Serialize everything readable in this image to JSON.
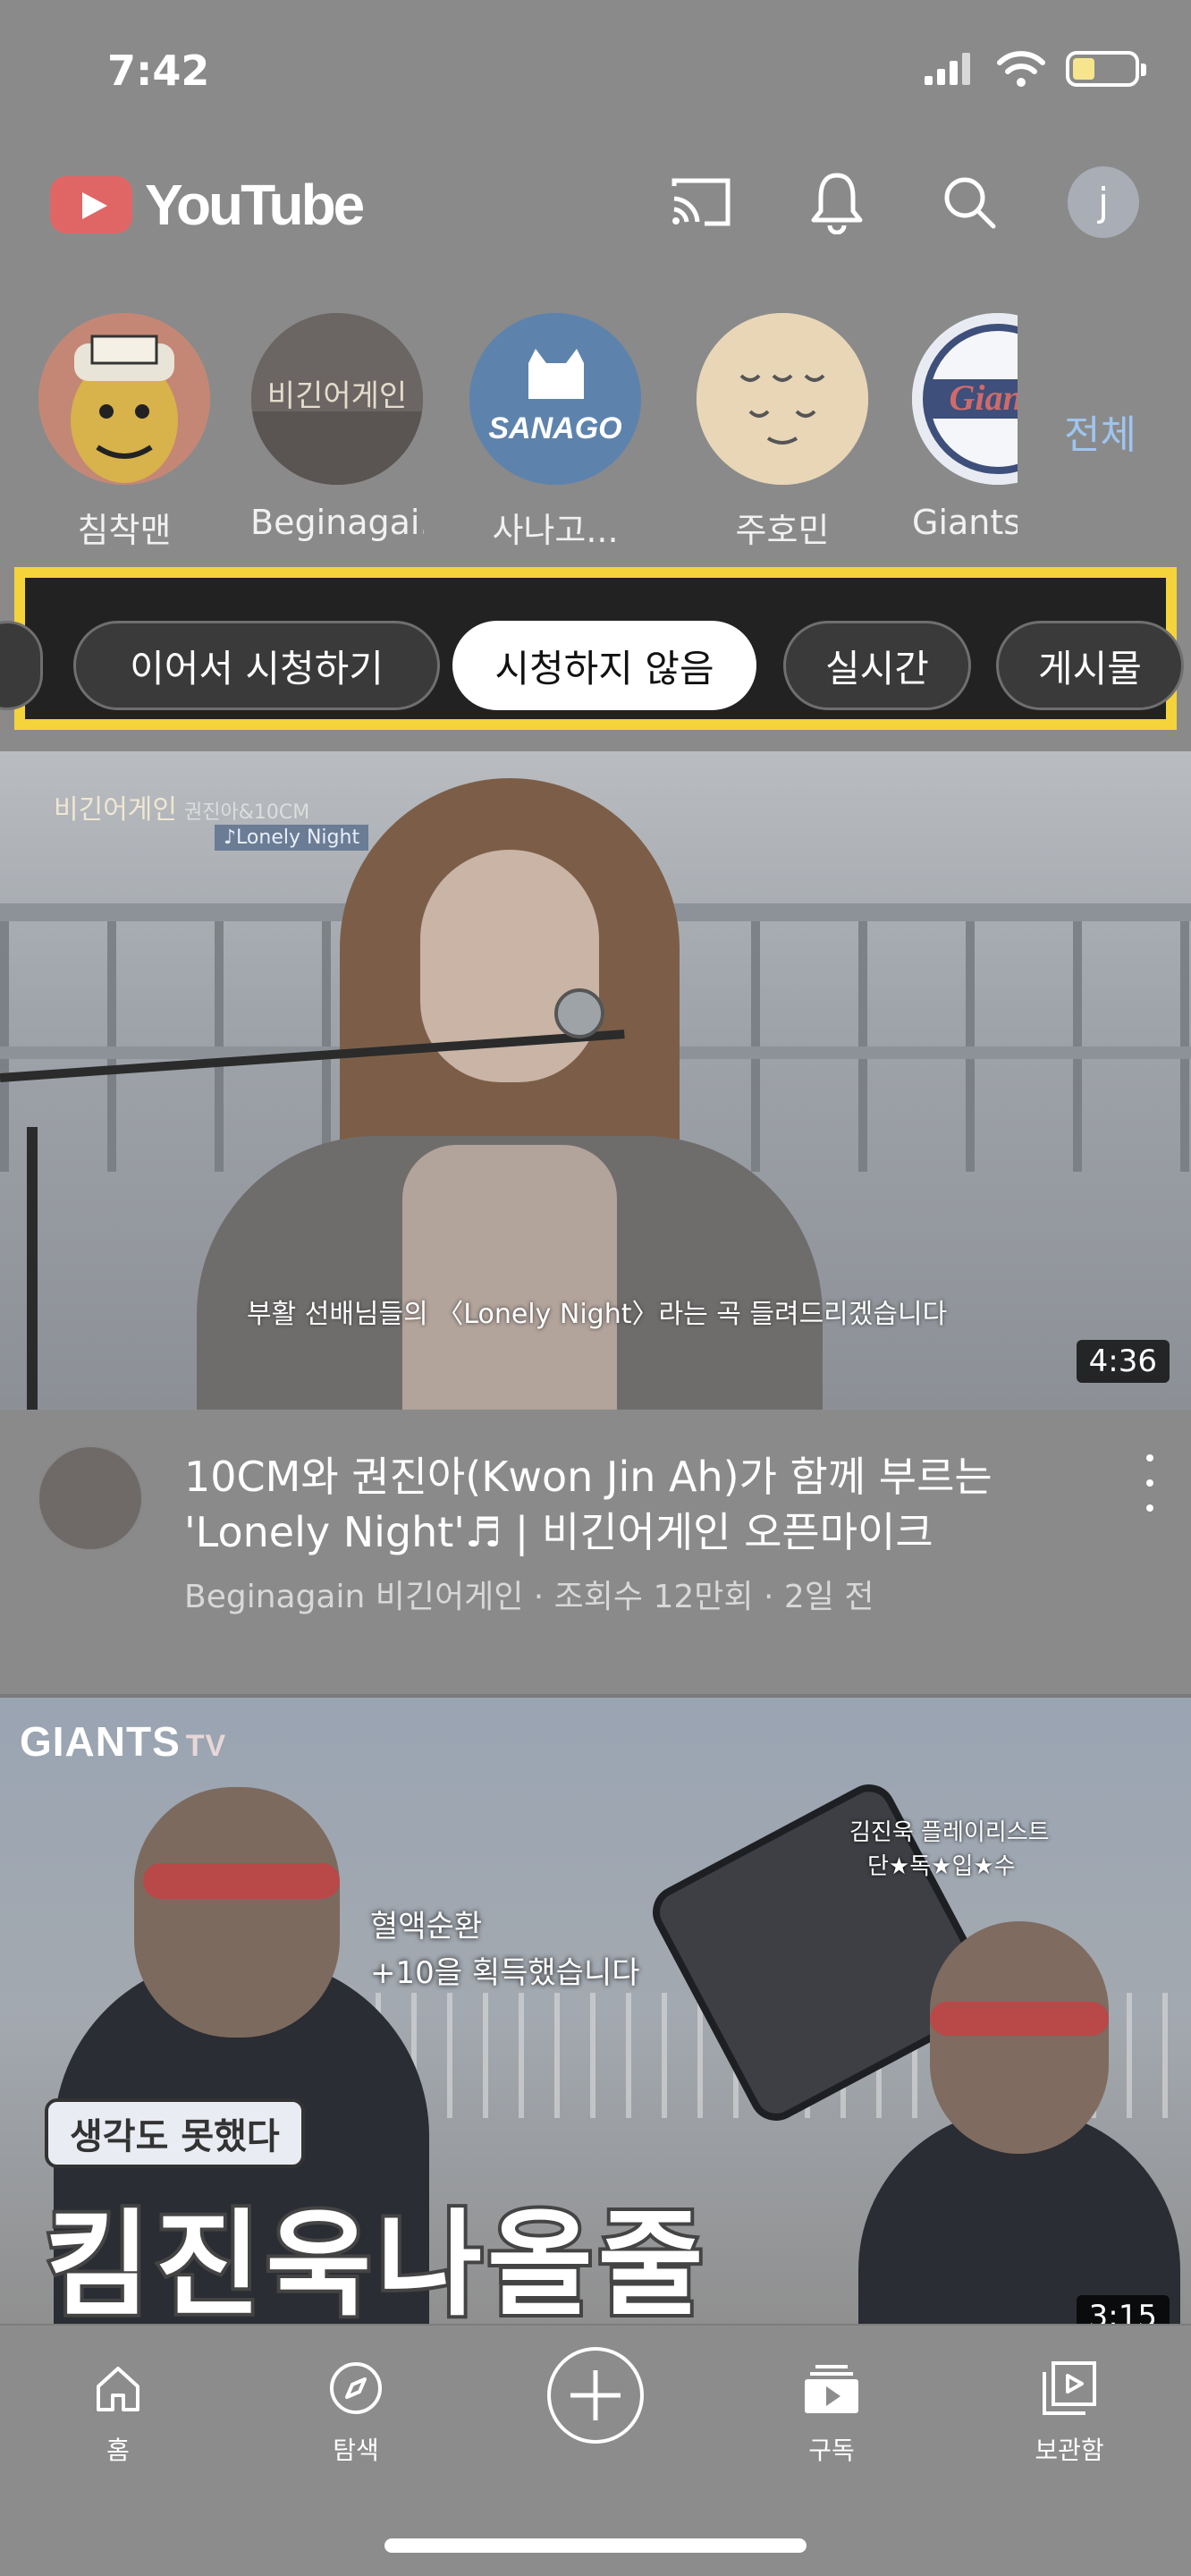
{
  "status_bar": {
    "time": "7:42"
  },
  "header": {
    "logo_text": "YouTube",
    "avatar_letter": "j"
  },
  "channels": {
    "items": [
      {
        "label": "침착맨"
      },
      {
        "label": "Beginagai..."
      },
      {
        "label": "사나고..."
      },
      {
        "label": "주호민"
      },
      {
        "label": "Giants"
      }
    ],
    "all_label": "전체",
    "sanago_logo_text": "SANAGO",
    "giants_logo_text": "Giants"
  },
  "chips": {
    "items": [
      {
        "label": "이어서 시청하기",
        "active": false
      },
      {
        "label": "시청하지 않음",
        "active": true
      },
      {
        "label": "실시간",
        "active": false
      },
      {
        "label": "게시물",
        "active": false
      }
    ],
    "highlight_color": "#f5d33b"
  },
  "videos": [
    {
      "thumb_overlay_title": "비긴어게인",
      "thumb_overlay_artists": "권진아&10CM",
      "thumb_overlay_song": "♪Lonely Night",
      "thumb_subtitle": "부활 선배님들의 〈Lonely Night〉라는 곡 들려드리겠습니다",
      "duration": "4:36",
      "title": "10CM와 권진아(Kwon Jin Ah)가 함께 부르는 'Lonely Night'♬ | 비긴어게인 오픈마이크",
      "meta": "Beginagain 비긴어게인 · 조회수 12만회 · 2일 전"
    },
    {
      "thumb_brand": "GIANTS",
      "thumb_brand_suffix": "TV",
      "thumb_caption_line1": "혈액순환",
      "thumb_caption_line2": "+10을 획득했습니다",
      "thumb_playlist_line1": "김진욱 플레이리스트",
      "thumb_playlist_line2": "단★독★입★수",
      "thumb_tag": "생각도 못했다",
      "thumb_big_text": "킴진욱나올줄",
      "duration": "3:15"
    }
  ],
  "bottom_nav": {
    "items": [
      {
        "label": "홈",
        "icon": "home-icon"
      },
      {
        "label": "탐색",
        "icon": "compass-icon"
      },
      {
        "label": "",
        "icon": "add-icon"
      },
      {
        "label": "구독",
        "icon": "subscriptions-icon"
      },
      {
        "label": "보관함",
        "icon": "library-icon"
      }
    ]
  }
}
